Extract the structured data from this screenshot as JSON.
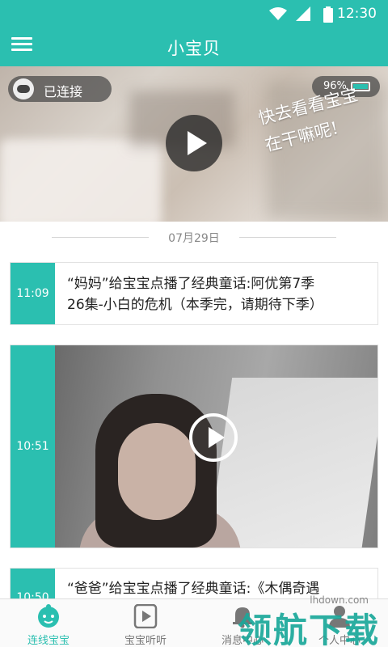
{
  "status_bar": {
    "time": "12:30",
    "icons": [
      "wifi-icon",
      "cell-signal-icon",
      "battery-icon"
    ]
  },
  "app_bar": {
    "title": "小宝贝",
    "menu_icon": "hamburger-menu-icon"
  },
  "hero": {
    "connection_label": "已连接",
    "battery_percent": "96%",
    "slogan_line1": "快去看看宝宝",
    "slogan_line2": "在干嘛呢!"
  },
  "feed": {
    "date": "07月29日",
    "items": [
      {
        "time": "11:09",
        "text_line1": "“妈妈”给宝宝点播了经典童话:阿优第7季",
        "text_line2": "26集-小白的危机（本季完，请期待下季）"
      },
      {
        "time": "10:51",
        "type": "video"
      },
      {
        "time": "10:50",
        "text_line1": "“爸爸”给宝宝点播了经典童话:《木偶奇遇"
      }
    ]
  },
  "tabs": [
    {
      "label": "连线宝宝",
      "icon": "baby-face-icon",
      "active": true
    },
    {
      "label": "宝宝听听",
      "icon": "play-square-icon",
      "active": false
    },
    {
      "label": "消息中心",
      "icon": "bell-icon",
      "active": false
    },
    {
      "label": "个人中心",
      "icon": "person-icon",
      "active": false
    }
  ],
  "overlay": {
    "brand": "领航下载",
    "site": "lhdown.com"
  },
  "colors": {
    "accent": "#2bbfb0",
    "text": "#222222"
  }
}
